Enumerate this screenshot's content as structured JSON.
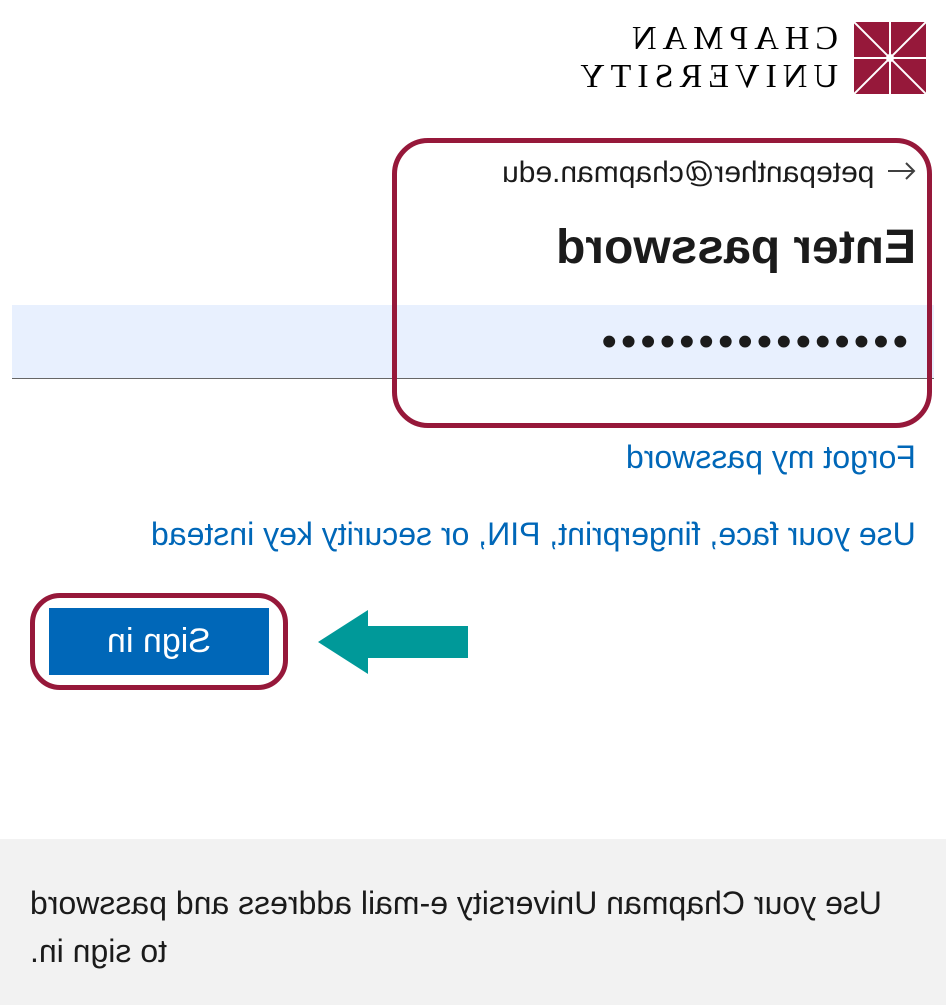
{
  "logo": {
    "line1": "CHAPMAN",
    "line2": "UNIVERSITY"
  },
  "account": {
    "email": "petepanther@chapman.edu"
  },
  "title": "Enter password",
  "password_dots": "••••••••••••••••",
  "links": {
    "forgot": "Forgot my password",
    "alt_signin": "Use your face, fingerprint, PIN, or security key instead"
  },
  "signin_label": "Sign in",
  "footer_text": "Use your Chapman University e-mail address and password to sign in.",
  "colors": {
    "accent": "#96183a",
    "link": "#0067b8",
    "primary_button": "#0067b8",
    "arrow": "#009999"
  }
}
